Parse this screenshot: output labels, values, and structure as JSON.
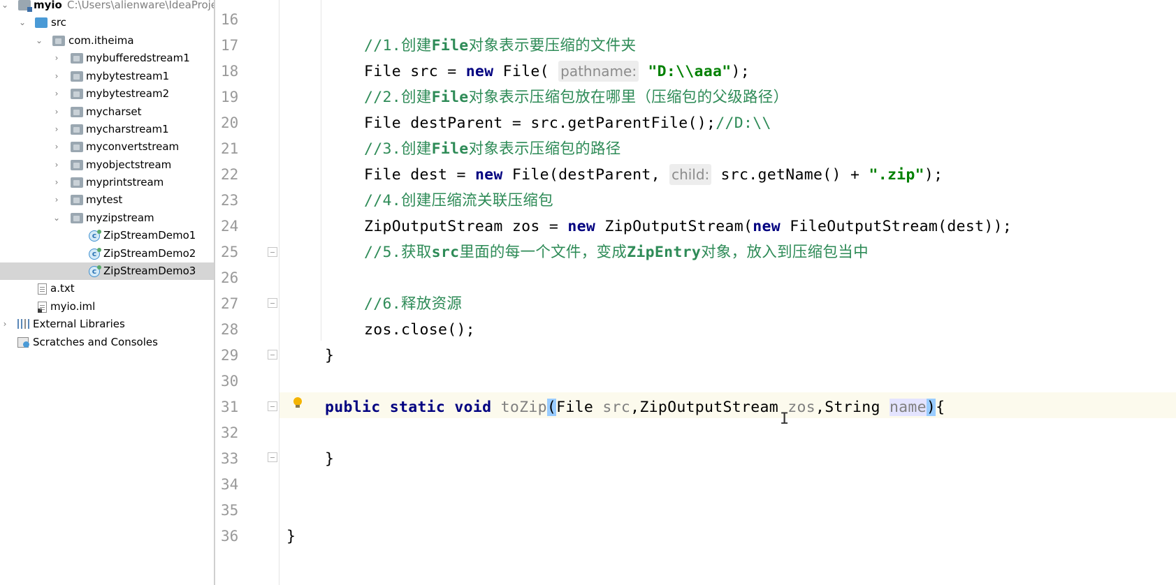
{
  "project_tree": {
    "root": {
      "name": "myio",
      "path": "C:\\Users\\alienware\\IdeaProje"
    },
    "src": "src",
    "package": "com.itheima",
    "folders": [
      "mybufferedstream1",
      "mybytestream1",
      "mybytestream2",
      "mycharset",
      "mycharstream1",
      "myconvertstream",
      "myobjectstream",
      "myprintstream",
      "mytest",
      "myzipstream"
    ],
    "classes": [
      "ZipStreamDemo1",
      "ZipStreamDemo2",
      "ZipStreamDemo3"
    ],
    "selected_class": "ZipStreamDemo3",
    "files": [
      "a.txt",
      "myio.iml"
    ],
    "external_libraries": "External Libraries",
    "scratches": "Scratches and Consoles"
  },
  "editor": {
    "line_numbers": [
      "16",
      "17",
      "18",
      "19",
      "20",
      "21",
      "22",
      "23",
      "24",
      "25",
      "26",
      "27",
      "28",
      "29",
      "30",
      "31",
      "32",
      "33",
      "34",
      "35",
      "36"
    ],
    "current_line": "31",
    "lines": {
      "l17": {
        "comment_a": "//1.创建",
        "comment_b": "File",
        "comment_c": "对象表示要压缩的文件夹"
      },
      "l18": {
        "a": "File src = ",
        "kw": "new",
        "b": " File( ",
        "hint": "pathname:",
        "str": "\"D:\\\\aaa\"",
        "c": ");"
      },
      "l19": {
        "comment_a": "//2.创建",
        "comment_b": "File",
        "comment_c": "对象表示压缩包放在哪里（压缩包的父级路径）"
      },
      "l20": {
        "a": "File destParent = src.getParentFile();",
        "comment": "//D:\\\\"
      },
      "l21": {
        "comment_a": "//3.创建",
        "comment_b": "File",
        "comment_c": "对象表示压缩包的路径"
      },
      "l22": {
        "a": "File dest = ",
        "kw": "new",
        "b": " File(destParent, ",
        "hint": "child:",
        "c": " src.getName() + ",
        "str": "\".zip\"",
        "d": ");"
      },
      "l23": {
        "comment": "//4.创建压缩流关联压缩包"
      },
      "l24": {
        "a": "ZipOutputStream zos = ",
        "kw1": "new",
        "b": " ZipOutputStream(",
        "kw2": "new",
        "c": " FileOutputStream(dest));"
      },
      "l25": {
        "comment_a": "//5.获取",
        "comment_b": "src",
        "comment_c": "里面的每一个文件，变成",
        "comment_d": "ZipEntry",
        "comment_e": "对象，放入到压缩包当中"
      },
      "l27": {
        "comment": "//6.释放资源"
      },
      "l28": {
        "code": "zos.close();"
      },
      "l29": {
        "code": "}"
      },
      "l31": {
        "kw": "public static void",
        "method": " toZip",
        "p1": "(",
        "a": "File ",
        "u1": "src",
        "b": ",ZipOutputStream ",
        "u2": "zos",
        "c": ",String ",
        "u3": "name",
        "p2": ")",
        "d": "{"
      },
      "l33": {
        "code": "}"
      },
      "l36": {
        "code": "}"
      }
    }
  },
  "colors": {
    "keyword": "#000080",
    "comment": "#2e8b57",
    "string": "#008000",
    "current_line": "#fcfaed",
    "selection": "#d5d5d5"
  }
}
